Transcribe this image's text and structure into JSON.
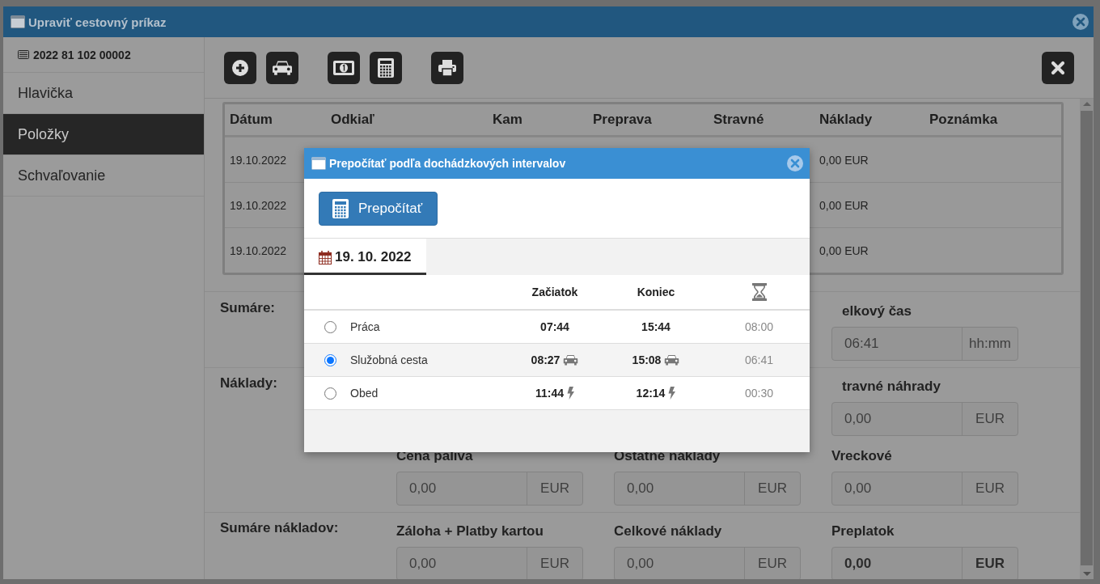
{
  "window": {
    "title": "Upraviť cestovný príkaz"
  },
  "sidebar": {
    "document_number": "2022 81 102 00002",
    "items": [
      {
        "label": "Hlavička",
        "selected": false
      },
      {
        "label": "Položky",
        "selected": true
      },
      {
        "label": "Schvaľovanie",
        "selected": false
      }
    ]
  },
  "table": {
    "columns": [
      "Dátum",
      "Odkiaľ",
      "Kam",
      "Preprava",
      "Stravné",
      "Náklady",
      "Poznámka"
    ],
    "rows": [
      {
        "date": "19.10.2022",
        "costs": "0,00 EUR"
      },
      {
        "date": "19.10.2022",
        "costs": "0,00 EUR"
      },
      {
        "date": "19.10.2022",
        "costs": "0,00 EUR"
      }
    ]
  },
  "sections": [
    {
      "label": "Sumáre:",
      "rows": [
        {
          "right": {
            "label": "elkový čas",
            "value": "06:41",
            "unit": "hh:mm",
            "partly_hidden": true
          }
        }
      ]
    },
    {
      "label": "Náklady:",
      "rows": [
        {
          "right": {
            "label": "travné náhrady",
            "value": "0,00",
            "unit": "EUR",
            "partly_hidden": true
          }
        },
        {
          "left": {
            "label": "Cena paliva",
            "value": "0,00",
            "unit": "EUR"
          },
          "middle": {
            "label": "Ostatné náklady",
            "value": "0,00",
            "unit": "EUR"
          },
          "right": {
            "label": "Vreckové",
            "value": "0,00",
            "unit": "EUR"
          }
        }
      ]
    },
    {
      "label": "Sumáre nákladov:",
      "rows": [
        {
          "left": {
            "label": "Záloha + Platby kartou",
            "value": "0,00",
            "unit": "EUR"
          },
          "middle": {
            "label": "Celkové náklady",
            "value": "0,00",
            "unit": "EUR"
          },
          "right": {
            "label": "Preplatok",
            "value": "0,00",
            "unit": "EUR",
            "emphasis": true
          }
        }
      ]
    }
  ],
  "dialog": {
    "title": "Prepočítať podľa dochádzkových intervalov",
    "action": "Prepočítať",
    "tabs": [
      {
        "label": "19. 10. 2022",
        "selected": true
      }
    ],
    "columns": [
      "Začiatok",
      "Koniec"
    ],
    "intervals": [
      {
        "name": "Práca",
        "start": "07:44",
        "end": "15:44",
        "duration": "08:00",
        "kind": "work",
        "selected": false
      },
      {
        "name": "Služobná cesta",
        "start": "08:27",
        "end": "15:08",
        "duration": "06:41",
        "kind": "trip",
        "selected": true
      },
      {
        "name": "Obed",
        "start": "11:44",
        "end": "12:14",
        "duration": "00:30",
        "kind": "break",
        "selected": false
      }
    ]
  }
}
